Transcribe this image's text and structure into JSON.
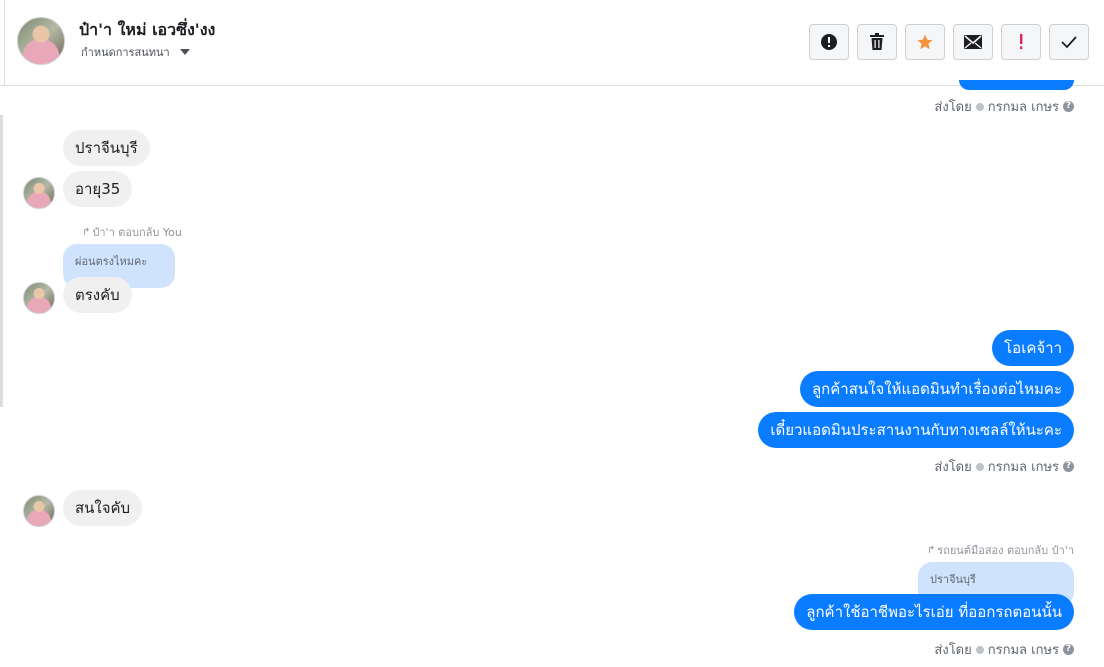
{
  "header": {
    "contact_name": "ป๋า'า ใหม่ เอวซึ่ง'งง",
    "subtitle": "กำหนดการสนทนา",
    "toolbar": [
      {
        "name": "alert-icon",
        "color": "#1c1e21"
      },
      {
        "name": "trash-icon",
        "color": "#1c1e21"
      },
      {
        "name": "star-icon",
        "color": "#f7923b"
      },
      {
        "name": "mail-icon",
        "color": "#1c1e21"
      },
      {
        "name": "exclamation-icon",
        "color": "#e0245e"
      },
      {
        "name": "check-icon",
        "color": "#1c1e21"
      }
    ]
  },
  "sent_by": {
    "prefix": "ส่งโดย",
    "sender": "กรกมล เกษร",
    "help": "?"
  },
  "messages": {
    "m1": "ปราจีนบุรี",
    "m2": "อายุ35",
    "reply1_note": "ป๋า'า ตอบกลับ You",
    "reply1_quote": "ผ่อนตรงไหมคะ",
    "m3": "ตรงคับ",
    "m4": "โอเคจ้าา",
    "m5": "ลูกค้าสนใจให้แอดมินทำเรื่องต่อไหมคะ",
    "m6": "เดี๋ยวแอดมินประสานงานกับทางเซลล์ให้นะคะ",
    "m7": "สนใจคับ",
    "reply2_note": "รถยนต์มือสอง ตอบกลับ ป๋า'า",
    "reply2_quote": "ปราจีนบุรี",
    "m8": "ลูกค้าใช้อาชีพอะไรเอ่ย ที่ออกรถตอนนั้น"
  },
  "colors": {
    "outgoing": "#0a7cff",
    "incoming": "#f1f0f0",
    "quoted": "#cfe4fc"
  }
}
